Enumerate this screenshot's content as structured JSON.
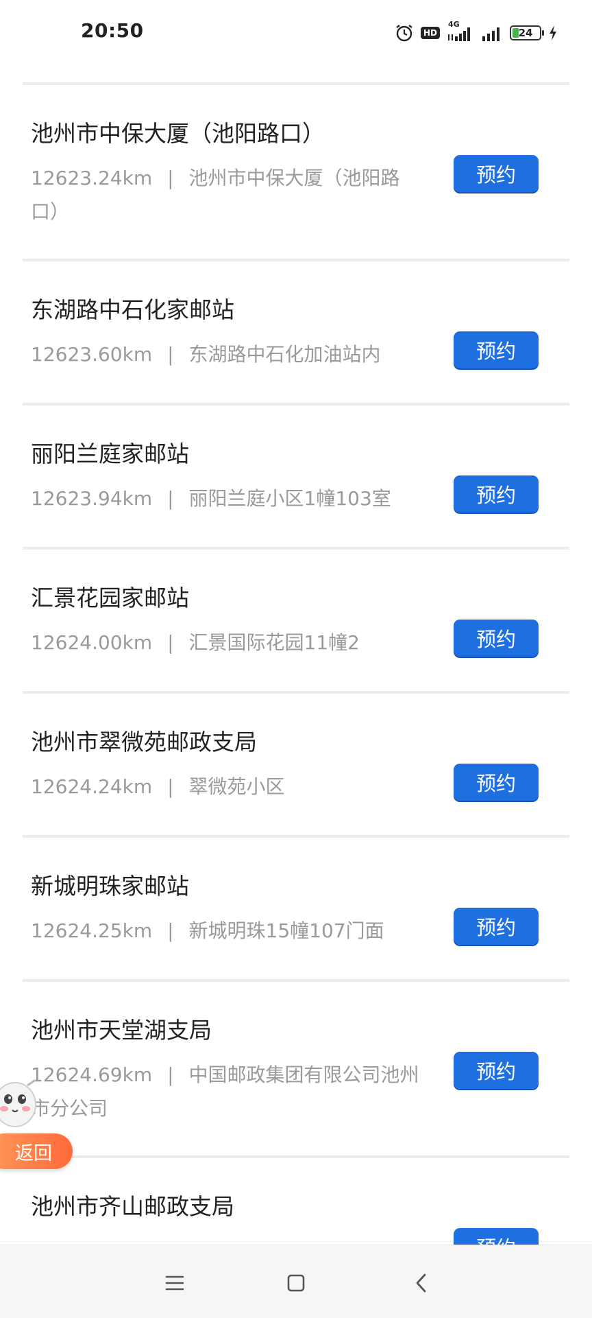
{
  "status_bar": {
    "time": "20:50",
    "icons": [
      "alarm-icon",
      "hd-icon",
      "4g-signal-icon",
      "signal-icon",
      "battery-icon",
      "charging-icon"
    ],
    "hd_label": "HD",
    "network_label": "4G",
    "battery_level": "24"
  },
  "list": {
    "items": [
      {
        "name": "池州市中保大厦（池阳路口）",
        "distance": "12623.24km",
        "separator": "|",
        "address": "池州市中保大厦（池阳路口）",
        "action": "预约"
      },
      {
        "name": "东湖路中石化家邮站",
        "distance": "12623.60km",
        "separator": "|",
        "address": "东湖路中石化加油站内",
        "action": "预约"
      },
      {
        "name": "丽阳兰庭家邮站",
        "distance": "12623.94km",
        "separator": "|",
        "address": "丽阳兰庭小区1幢103室",
        "action": "预约"
      },
      {
        "name": "汇景花园家邮站",
        "distance": "12624.00km",
        "separator": "|",
        "address": "汇景国际花园11幢2",
        "action": "预约"
      },
      {
        "name": "池州市翠微苑邮政支局",
        "distance": "12624.24km",
        "separator": "|",
        "address": "翠微苑小区",
        "action": "预约"
      },
      {
        "name": "新城明珠家邮站",
        "distance": "12624.25km",
        "separator": "|",
        "address": "新城明珠15幢107门面",
        "action": "预约"
      },
      {
        "name": "池州市天堂湖支局",
        "distance": "12624.69km",
        "separator": "|",
        "address": "中国邮政集团有限公司池州市分公司",
        "action": "预约"
      },
      {
        "name": "池州市齐山邮政支局",
        "distance": "",
        "separator": "",
        "address": "",
        "action": "预约"
      }
    ]
  },
  "floating": {
    "back_label": "返回",
    "mascot_icon": "mascot-icon"
  },
  "nav_bar": {
    "icons": [
      "menu-icon",
      "home-icon",
      "back-icon"
    ]
  },
  "colors": {
    "button": "#1e6fe0",
    "back_pill": "#ff7a45",
    "meta_text": "#9a9a9a"
  }
}
